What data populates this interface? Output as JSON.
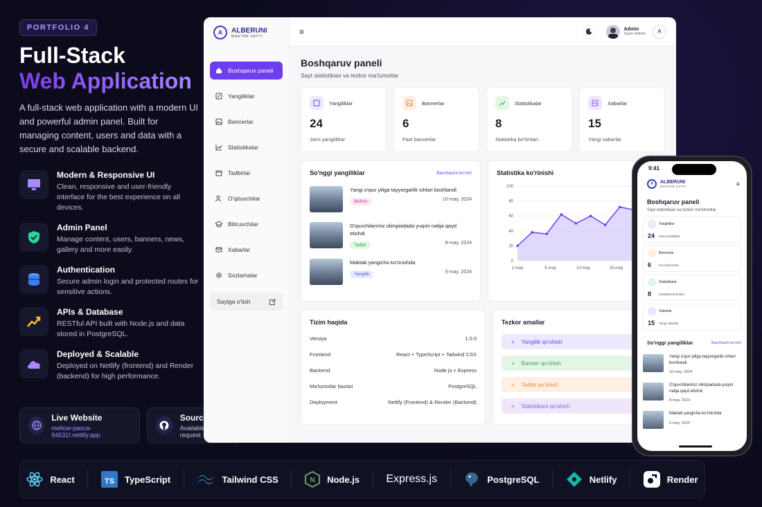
{
  "left": {
    "badge": "PORTFOLIO 4",
    "title1": "Full-Stack",
    "title2": "Web Application",
    "intro": "A full-stack web application with a modern UI and powerful admin panel. Built for managing content, users and data with a secure and scalable backend.",
    "features": [
      {
        "title": "Modern & Responsive UI",
        "desc": "Clean, responsive and user-friendly interface for the best experience on all devices."
      },
      {
        "title": "Admin Panel",
        "desc": "Manage content, users, banners, news, gallery and more easily."
      },
      {
        "title": "Authentication",
        "desc": "Secure admin login and protected routes for sensitive actions."
      },
      {
        "title": "APIs & Database",
        "desc": "RESTful API built with Node.js and data stored in PostgreSQL."
      },
      {
        "title": "Deployed & Scalable",
        "desc": "Deployed on Netlify (frontend) and Render (backend) for high performance."
      }
    ],
    "live": {
      "title": "Live Website",
      "sub": "mellow-pasca-94631f.netlify.app"
    },
    "source": {
      "title": "Source Code",
      "sub": "Available on request"
    }
  },
  "tech": [
    "React",
    "TypeScript",
    "Tailwind CSS",
    "Node.js",
    "Express.js",
    "PostgreSQL",
    "Netlify",
    "Render"
  ],
  "dash": {
    "logo": "ALBERUNI",
    "logo_sub": "MAKTAB SAYTI",
    "menu_icon": "≡",
    "nav": [
      "Boshqaruv paneli",
      "Yangiliklar",
      "Bannerlar",
      "Statistikalar",
      "Tadbirlar",
      "O'qituvchilar",
      "Bitiruvchilar",
      "Xabarlar",
      "Sozlamalar"
    ],
    "goto": "Saytga o'tish",
    "user": {
      "name": "Admin",
      "role": "Super Admin",
      "initial": "A"
    },
    "title": "Boshqaruv paneli",
    "subtitle": "Sayt statistikasi va tezkor ma'lumotlar",
    "cards": [
      {
        "label": "Yangiliklar",
        "value": "24",
        "desc": "Jami yangiliklar"
      },
      {
        "label": "Bannerlar",
        "value": "6",
        "desc": "Faol bannerlar"
      },
      {
        "label": "Statistikalar",
        "value": "8",
        "desc": "Statistika bo'limlari"
      },
      {
        "label": "Xabarlar",
        "value": "15",
        "desc": "Yangi xabarlar"
      }
    ],
    "news_title": "So'nggi yangiliklar",
    "news_all": "Barchasini ko'rish",
    "news": [
      {
        "title": "Yangi o'quv yiliga tayyorgarlik ishlari boshlandi",
        "tag": "Muhim",
        "date": "10-may, 2024"
      },
      {
        "title": "O'quvchilarimiz olimpiadada yuqori natija qayd etishdi",
        "tag": "Tadbir",
        "date": "8-may, 2024"
      },
      {
        "title": "Maktab yangicha ko'rinishda",
        "tag": "Yangilik",
        "date": "5-may, 2024"
      }
    ],
    "chart_title": "Statistika ko'rinishi",
    "sys_title": "Tizim haqida",
    "sys": [
      {
        "k": "Versiya",
        "v": "1.0.0"
      },
      {
        "k": "Frontend",
        "v": "React + TypeScript + Tailwind CSS"
      },
      {
        "k": "Backend",
        "v": "Node.js + Express"
      },
      {
        "k": "Ma'lumotlar bazasi",
        "v": "PostgreSQL"
      },
      {
        "k": "Deployment",
        "v": "Netlify (Frontend) & Render (Backend)"
      }
    ],
    "qa_title": "Tezkor amallar",
    "qa": [
      "Yangilik qo'shish",
      "Banner qo'shish",
      "Tadbir qo'shish",
      "Statistikani qo'shish"
    ]
  },
  "phone": {
    "time": "9:41",
    "cards": [
      {
        "label": "Yangiliklar",
        "value": "24",
        "desc": "Jami yangiliklar"
      },
      {
        "label": "Bannerlar",
        "value": "6",
        "desc": "Faol bannerlar"
      },
      {
        "label": "Statistikalar",
        "value": "8",
        "desc": "Statistika bo'limlari"
      },
      {
        "label": "Xabarlar",
        "value": "15",
        "desc": "Yangi xabarlar"
      }
    ],
    "news": [
      {
        "title": "Yangi o'quv yiliga tayyorgarlik ishlari boshlandi",
        "date": "10-may, 2024"
      },
      {
        "title": "O'quvchilarimiz olimpiadada yuqori natija qayd etishdi",
        "date": "8-may, 2024"
      },
      {
        "title": "Maktab yangicha ko'rinishda",
        "date": "5-may, 2024"
      }
    ]
  },
  "colors": {
    "accent": "#6d3df0",
    "muhim": "#fde7f3",
    "tadbir": "#e3f6e6",
    "yangilik": "#e6eaff"
  },
  "chart_data": {
    "type": "area",
    "x": [
      "1-may",
      "5-may",
      "10-may",
      "15-may",
      "20-may"
    ],
    "series": [
      {
        "values": [
          20,
          38,
          36,
          62,
          50,
          60,
          48,
          72,
          68,
          80
        ]
      }
    ],
    "ylim": [
      0,
      100
    ],
    "yticks": [
      0,
      20,
      40,
      60,
      80,
      100
    ],
    "grid": true
  }
}
